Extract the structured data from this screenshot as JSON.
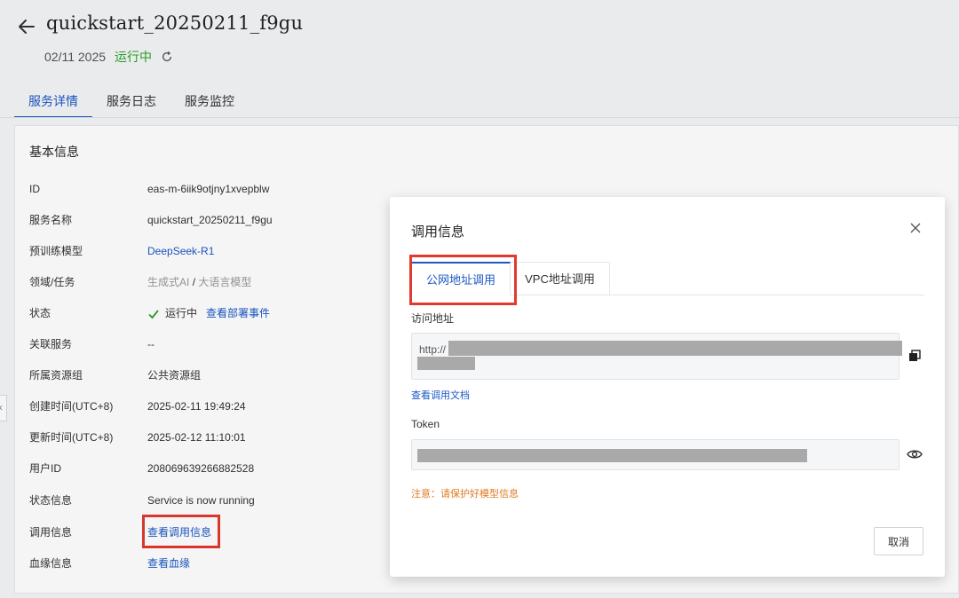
{
  "header": {
    "title": "quickstart_20250211_f9gu",
    "date": "02/11 2025",
    "status": "运行中"
  },
  "tabs": [
    "服务详情",
    "服务日志",
    "服务监控"
  ],
  "basic_info": {
    "title": "基本信息",
    "rows": [
      {
        "label": "ID",
        "value": "eas-m-6iik9otjny1xvepblw"
      },
      {
        "label": "服务名称",
        "value": "quickstart_20250211_f9gu"
      },
      {
        "label": "预训练模型",
        "value": "DeepSeek-R1"
      },
      {
        "label": "领域/任务",
        "value_a": "生成式AI",
        "sep": "/",
        "value_b": "大语言模型"
      },
      {
        "label": "状态",
        "value": "运行中",
        "link": "查看部署事件"
      },
      {
        "label": "关联服务",
        "value": "--"
      },
      {
        "label": "所属资源组",
        "value": "公共资源组"
      },
      {
        "label": "创建时间(UTC+8)",
        "value": "2025-02-11 19:49:24"
      },
      {
        "label": "更新时间(UTC+8)",
        "value": "2025-02-12 11:10:01"
      },
      {
        "label": "用户ID",
        "value": "208069639266882528"
      },
      {
        "label": "状态信息",
        "value": "Service is now running"
      },
      {
        "label": "调用信息",
        "value": "查看调用信息"
      },
      {
        "label": "血缘信息",
        "value": "查看血缘"
      }
    ]
  },
  "dialog": {
    "title": "调用信息",
    "tabs": [
      "公网地址调用",
      "VPC地址调用"
    ],
    "url_label": "访问地址",
    "url_prefix": "http://",
    "doc_link": "查看调用文档",
    "token_label": "Token",
    "warning": "注意：请保护好模型信息",
    "cancel_label": "取消"
  },
  "colors": {
    "accent": "#1b58c4",
    "running": "#2ba02b",
    "highlight": "#e23a2f",
    "warning": "#e07a1f"
  }
}
